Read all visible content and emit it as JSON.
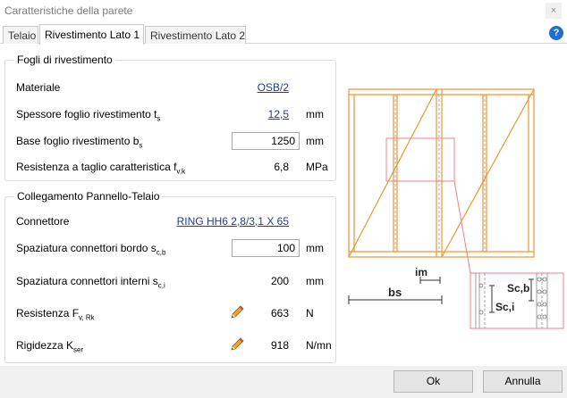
{
  "window": {
    "title": "Caratteristiche della parete",
    "close_glyph": "×"
  },
  "tabs": [
    {
      "label": "Telaio"
    },
    {
      "label": "Rivestimento Lato 1",
      "active": true
    },
    {
      "label": "Rivestimento Lato 2"
    }
  ],
  "help_glyph": "?",
  "fogli": {
    "title": "Fogli di rivestimento",
    "materiale": {
      "label": "Materiale",
      "value": "OSB/2"
    },
    "spessore": {
      "label": "Spessore foglio rivestimento t",
      "sub": "s",
      "value": "12,5",
      "unit": "mm"
    },
    "base": {
      "label": "Base foglio rivestimento b",
      "sub": "s",
      "value": "1250",
      "unit": "mm"
    },
    "resistenza": {
      "label": "Resistenza a taglio caratteristica f",
      "sub": "v,k",
      "value": "6,8",
      "unit": "MPa"
    }
  },
  "collegamento": {
    "title": "Collegamento Pannello-Telaio",
    "connettore": {
      "label": "Connettore",
      "value": "RING HH6 2,8/3,1 X 65"
    },
    "bordo": {
      "label": "Spaziatura connettori bordo s",
      "sub": "c,b",
      "value": "100",
      "unit": "mm"
    },
    "interni": {
      "label": "Spaziatura connettori interni s",
      "sub": "c,i",
      "value": "200",
      "unit": "mm"
    },
    "resistenza": {
      "label": "Resistenza F",
      "sub": "v, Rk",
      "value": "663",
      "unit": "N"
    },
    "rigidezza": {
      "label": "Rigidezza K",
      "sub": "ser",
      "value": "918",
      "unit": "N/mn"
    }
  },
  "diagram": {
    "im_label": "im",
    "bs_label": "bs",
    "scb_label": "Sc,b",
    "sci_label": "Sc,i"
  },
  "buttons": {
    "ok": "Ok",
    "cancel": "Annulla"
  },
  "colors": {
    "frame": "#e39a37",
    "highlight": "#f08080",
    "link": "#1d3f9a"
  },
  "icons": {
    "edit": "pencil-icon",
    "help": "help-icon",
    "close": "close-icon"
  }
}
